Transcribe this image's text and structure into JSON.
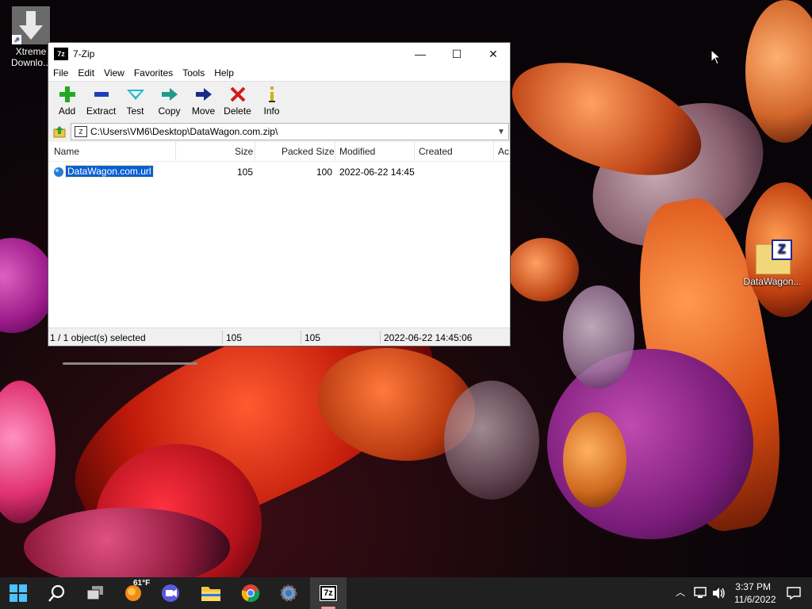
{
  "desktop": {
    "icons": [
      {
        "label": "Xtreme Downlo...",
        "line1": "Xtreme",
        "line2": "Downlo..."
      },
      {
        "label": "DataWagon..."
      }
    ]
  },
  "window": {
    "title": "7-Zip",
    "app_icon": "7z",
    "controls": {
      "minimize": "—",
      "maximize": "☐",
      "close": "✕"
    },
    "menu": [
      "File",
      "Edit",
      "View",
      "Favorites",
      "Tools",
      "Help"
    ],
    "toolbar": [
      {
        "label": "Add",
        "icon": "plus-icon",
        "color": "#22aa22"
      },
      {
        "label": "Extract",
        "icon": "minus-icon",
        "color": "#1a3fb8"
      },
      {
        "label": "Test",
        "icon": "check-icon",
        "color": "#2bb6c9"
      },
      {
        "label": "Copy",
        "icon": "copy-arrow-icon",
        "color": "#1f9a8a"
      },
      {
        "label": "Move",
        "icon": "move-arrow-icon",
        "color": "#1a2a8a"
      },
      {
        "label": "Delete",
        "icon": "x-icon",
        "color": "#d01c1c"
      },
      {
        "label": "Info",
        "icon": "info-icon",
        "color": "#c9b400"
      }
    ],
    "address": "C:\\Users\\VM6\\Desktop\\DataWagon.com.zip\\",
    "columns": [
      "Name",
      "Size",
      "Packed Size",
      "Modified",
      "Created",
      "Ac"
    ],
    "rows": [
      {
        "name": "DataWagon.com.url",
        "size": "105",
        "packed": "100",
        "modified": "2022-06-22 14:45",
        "created": ""
      }
    ],
    "status": {
      "selection": "1 / 1 object(s) selected",
      "size": "105",
      "packed": "105",
      "modified": "2022-06-22 14:45:06"
    }
  },
  "taskbar": {
    "weather": "61°F",
    "time": "3:37 PM",
    "date": "11/6/2022",
    "active_app": "7z"
  },
  "colors": {
    "taskbar": "#202020",
    "selection": "#0a5fd1"
  }
}
